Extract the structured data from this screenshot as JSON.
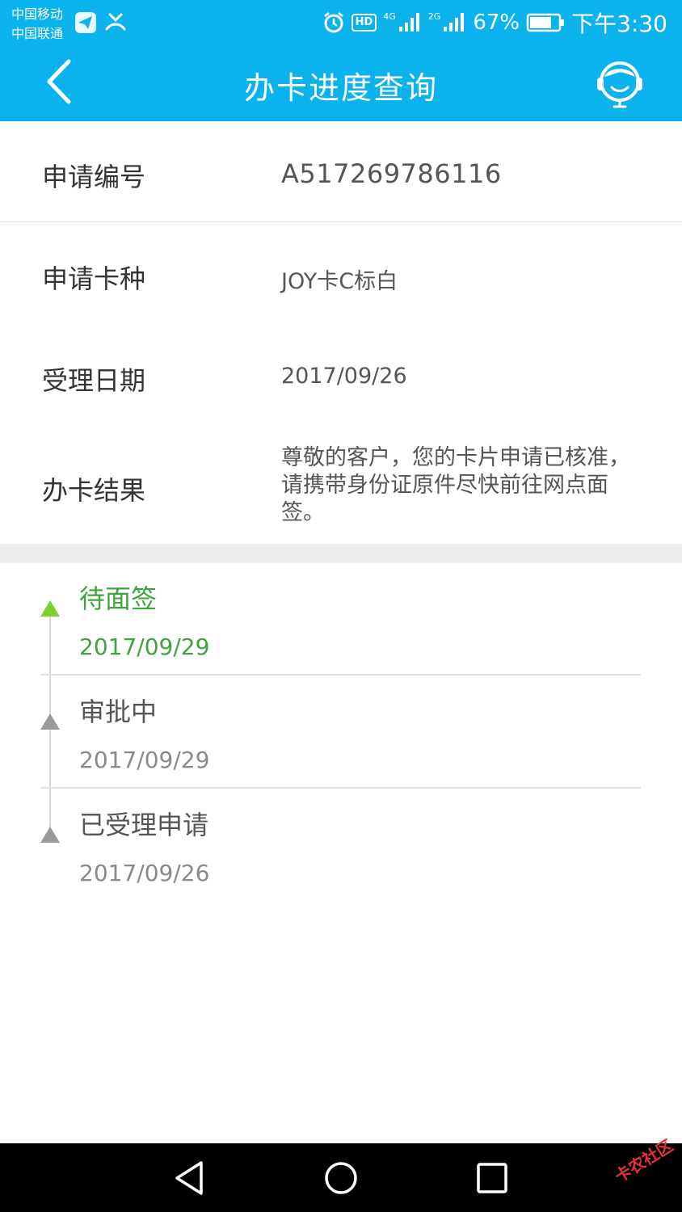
{
  "status_bar": {
    "carrier_1": "中国移动",
    "carrier_2": "中国联通",
    "network_1": "4G",
    "network_2": "2G",
    "battery": "67%",
    "time": "下午3:30",
    "hd_badge": "HD",
    "icons": [
      "plane-app-icon",
      "missed-call-icon",
      "alarm-icon",
      "hd-icon",
      "signal-icon",
      "battery-icon"
    ]
  },
  "header": {
    "title": "办卡进度查询",
    "back_icon": "chevron-left-icon",
    "support_icon": "customer-service-icon"
  },
  "info": {
    "number": {
      "label": "申请编号",
      "value": "A517269786116"
    },
    "card": {
      "label": "申请卡种",
      "value": "JOY卡C标白"
    },
    "date": {
      "label": "受理日期",
      "value": "2017/09/26"
    },
    "result": {
      "label": "办卡结果",
      "value": "尊敬的客户，您的卡片申请已核准，请携带身份证原件尽快前往网点面签。"
    }
  },
  "timeline": [
    {
      "status": "待面签",
      "date": "2017/09/29",
      "active": true
    },
    {
      "status": "审批中",
      "date": "2017/09/29",
      "active": false
    },
    {
      "status": "已受理申请",
      "date": "2017/09/26",
      "active": false
    }
  ],
  "colors": {
    "header_bg": "#0ab2ee",
    "active_green": "#3ea43e",
    "active_marker": "#7ed02a",
    "inactive_marker": "#9a9a9a"
  },
  "nav": {
    "icons": [
      "nav-back-icon",
      "nav-home-icon",
      "nav-recents-icon"
    ],
    "watermark": "卡农社区"
  }
}
